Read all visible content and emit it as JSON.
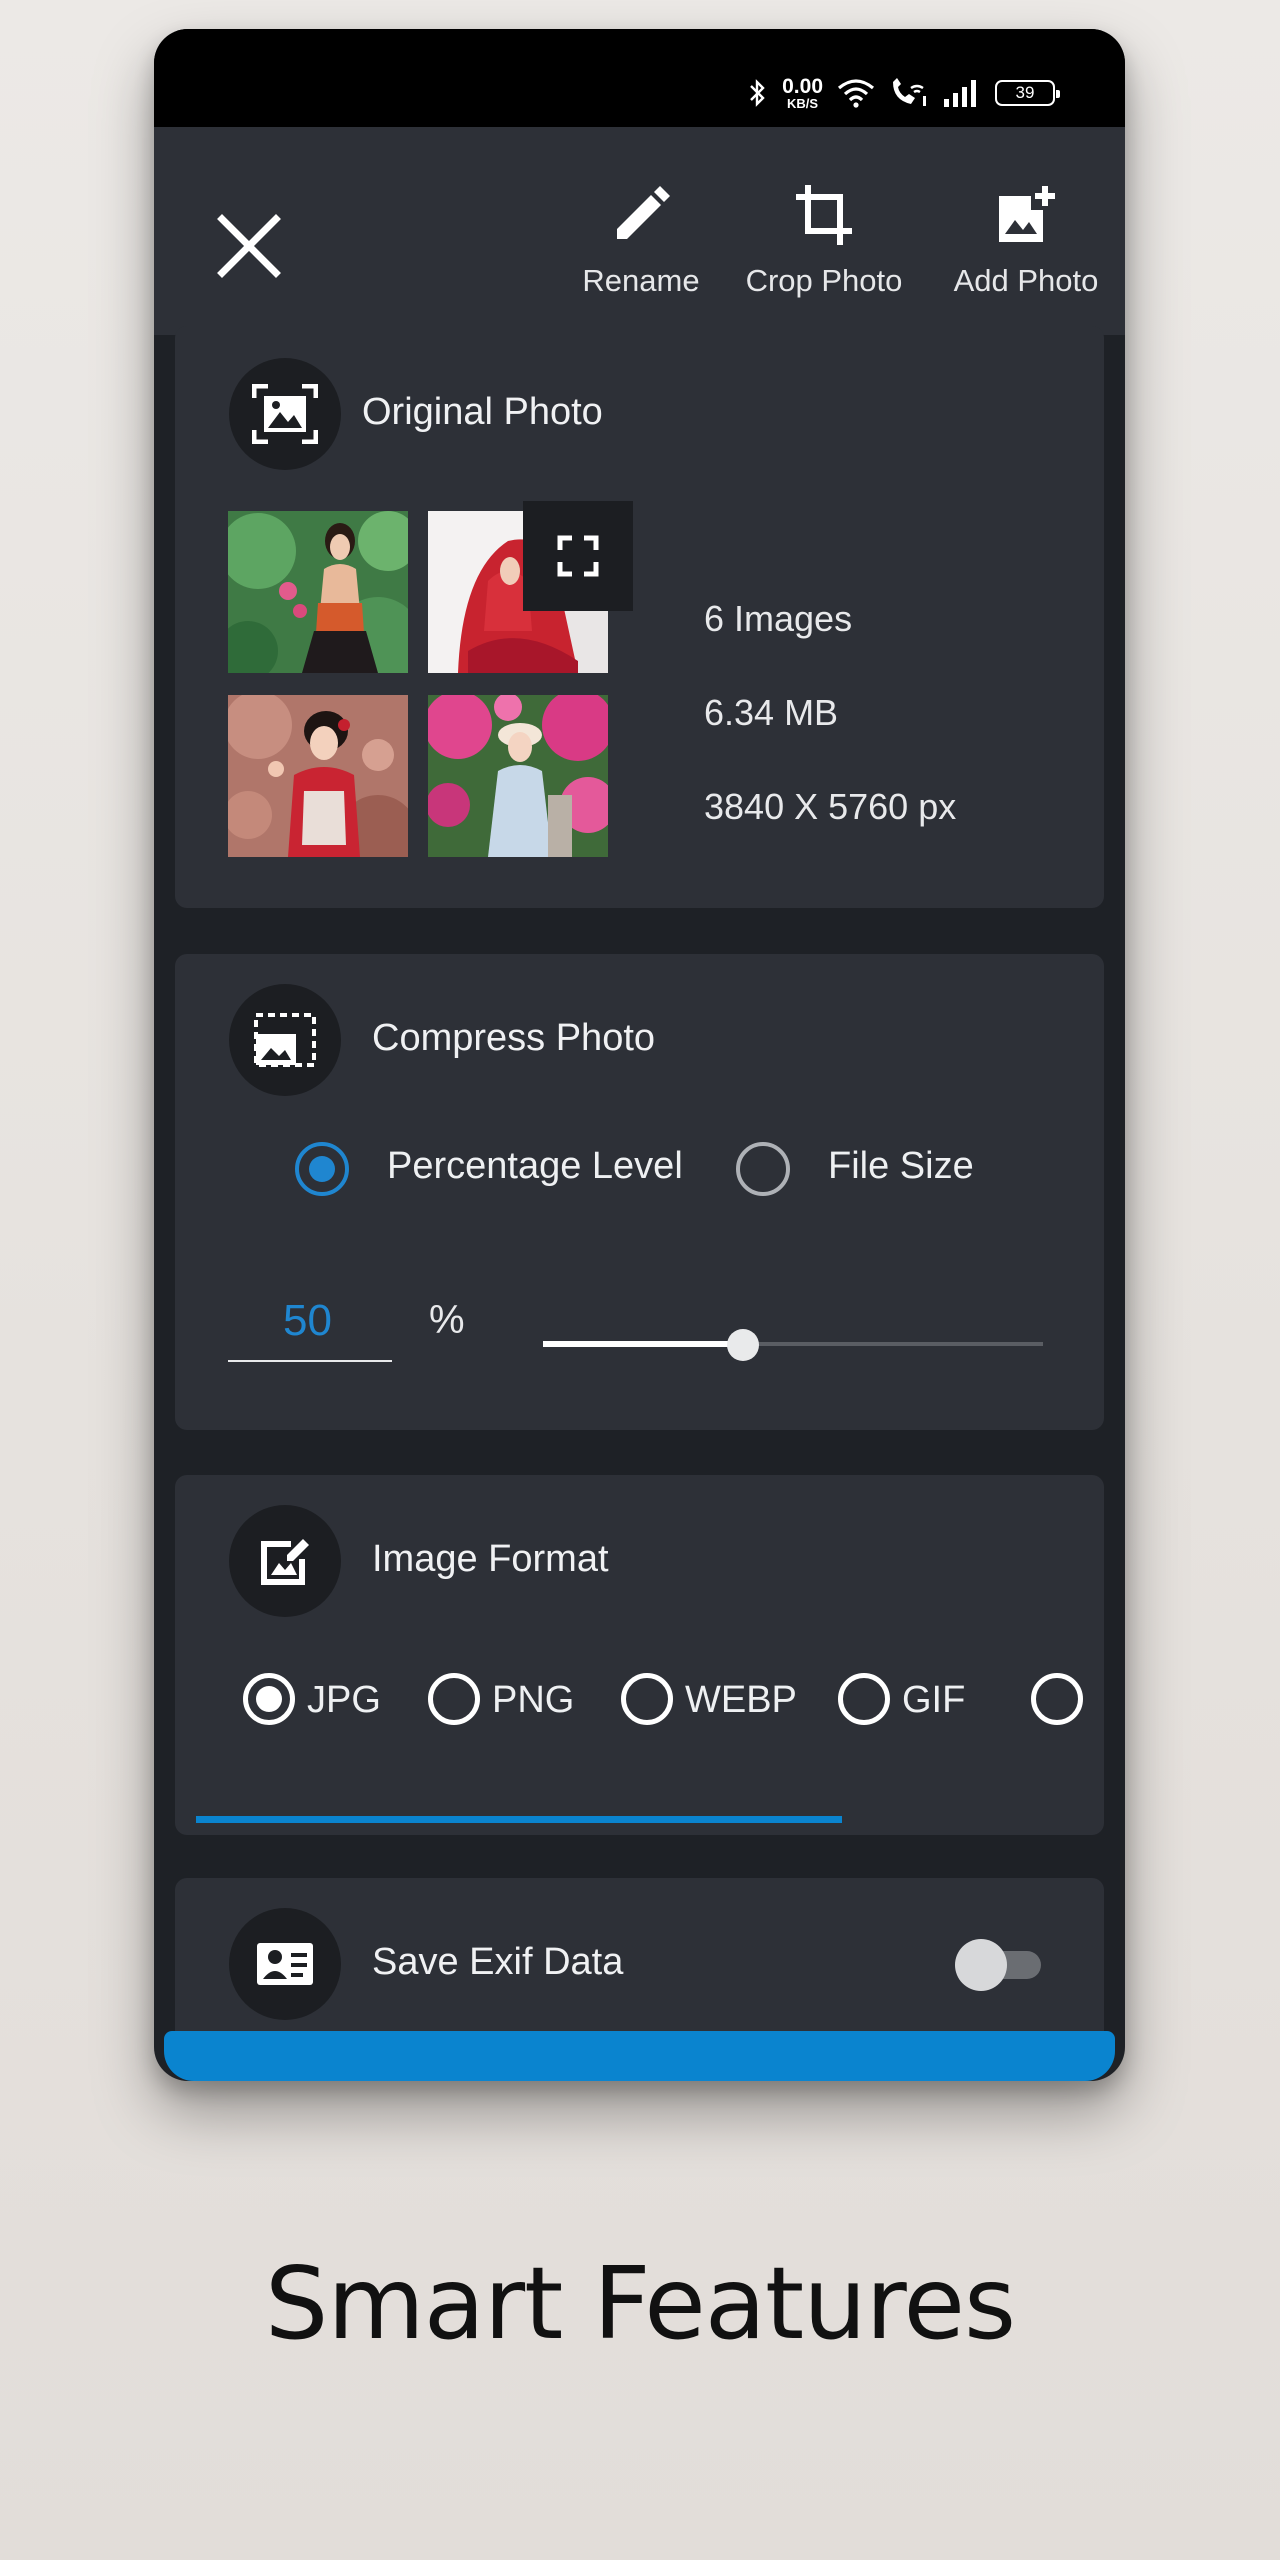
{
  "status_bar": {
    "net_speed_value": "0.00",
    "net_speed_unit": "KB/S",
    "battery": "39"
  },
  "toolbar": {
    "rename_label": "Rename",
    "crop_label": "Crop Photo",
    "add_label": "Add Photo"
  },
  "original_photo": {
    "title": "Original Photo",
    "image_count": "6 Images",
    "file_size": "6.34 MB",
    "dimensions": "3840 X 5760 px"
  },
  "compress_photo": {
    "title": "Compress Photo",
    "option_percentage": "Percentage Level",
    "option_file_size": "File Size",
    "selected_option": "Percentage Level",
    "value": "50",
    "unit": "%",
    "slider_level": 0.4
  },
  "image_format": {
    "title": "Image Format",
    "options": [
      "JPG",
      "PNG",
      "WEBP",
      "GIF"
    ],
    "selected": "JPG"
  },
  "save_exif": {
    "title": "Save Exif Data",
    "enabled": false
  },
  "tagline": "Smart Features",
  "colors": {
    "accent": "#1f86d0",
    "button_blue": "#0a84cf",
    "card_bg": "#2d3037",
    "screen_bg": "#1e2126"
  }
}
